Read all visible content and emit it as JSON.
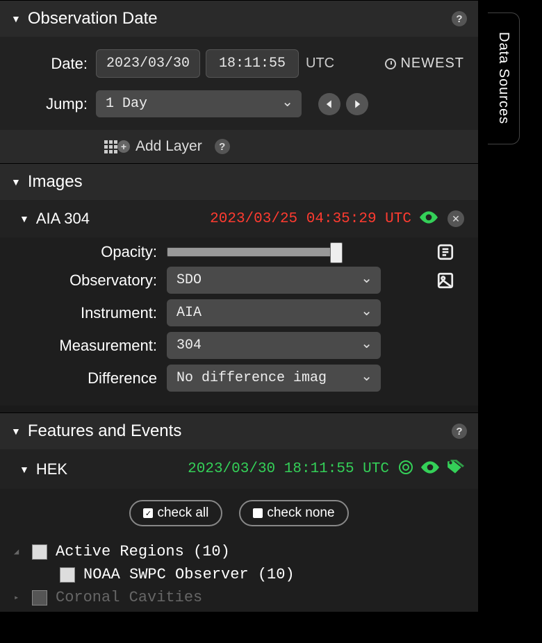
{
  "sidebar_tab": "Data Sources",
  "obs": {
    "title": "Observation Date",
    "date_label": "Date:",
    "date_value": "2023/03/30",
    "time_value": "18:11:55",
    "utc": "UTC",
    "newest": "NEWEST",
    "jump_label": "Jump:",
    "jump_value": "1 Day"
  },
  "toolbar": {
    "add_layer": "Add Layer"
  },
  "images": {
    "title": "Images",
    "layer_name": "AIA 304",
    "layer_ts": "2023/03/25 04:35:29 UTC",
    "opacity_label": "Opacity:",
    "observatory_label": "Observatory:",
    "observatory_value": "SDO",
    "instrument_label": "Instrument:",
    "instrument_value": "AIA",
    "measurement_label": "Measurement:",
    "measurement_value": "304",
    "difference_label": "Difference",
    "difference_value": "No difference imag"
  },
  "features": {
    "title": "Features and Events",
    "hek": "HEK",
    "hek_ts": "2023/03/30 18:11:55 UTC",
    "check_all": "check all",
    "check_none": "check none",
    "tree": {
      "active_regions": "Active Regions  (10)",
      "noaa": "NOAA SWPC Observer  (10)",
      "coronal": "Coronal Cavities"
    }
  }
}
